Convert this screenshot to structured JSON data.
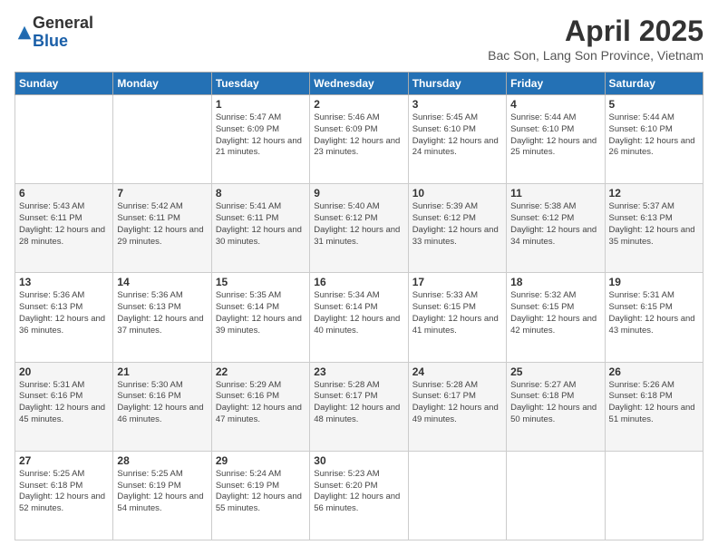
{
  "logo": {
    "general": "General",
    "blue": "Blue"
  },
  "title": {
    "month_year": "April 2025",
    "location": "Bac Son, Lang Son Province, Vietnam"
  },
  "headers": [
    "Sunday",
    "Monday",
    "Tuesday",
    "Wednesday",
    "Thursday",
    "Friday",
    "Saturday"
  ],
  "weeks": [
    [
      {
        "day": "",
        "sunrise": "",
        "sunset": "",
        "daylight": ""
      },
      {
        "day": "",
        "sunrise": "",
        "sunset": "",
        "daylight": ""
      },
      {
        "day": "1",
        "sunrise": "Sunrise: 5:47 AM",
        "sunset": "Sunset: 6:09 PM",
        "daylight": "Daylight: 12 hours and 21 minutes."
      },
      {
        "day": "2",
        "sunrise": "Sunrise: 5:46 AM",
        "sunset": "Sunset: 6:09 PM",
        "daylight": "Daylight: 12 hours and 23 minutes."
      },
      {
        "day": "3",
        "sunrise": "Sunrise: 5:45 AM",
        "sunset": "Sunset: 6:10 PM",
        "daylight": "Daylight: 12 hours and 24 minutes."
      },
      {
        "day": "4",
        "sunrise": "Sunrise: 5:44 AM",
        "sunset": "Sunset: 6:10 PM",
        "daylight": "Daylight: 12 hours and 25 minutes."
      },
      {
        "day": "5",
        "sunrise": "Sunrise: 5:44 AM",
        "sunset": "Sunset: 6:10 PM",
        "daylight": "Daylight: 12 hours and 26 minutes."
      }
    ],
    [
      {
        "day": "6",
        "sunrise": "Sunrise: 5:43 AM",
        "sunset": "Sunset: 6:11 PM",
        "daylight": "Daylight: 12 hours and 28 minutes."
      },
      {
        "day": "7",
        "sunrise": "Sunrise: 5:42 AM",
        "sunset": "Sunset: 6:11 PM",
        "daylight": "Daylight: 12 hours and 29 minutes."
      },
      {
        "day": "8",
        "sunrise": "Sunrise: 5:41 AM",
        "sunset": "Sunset: 6:11 PM",
        "daylight": "Daylight: 12 hours and 30 minutes."
      },
      {
        "day": "9",
        "sunrise": "Sunrise: 5:40 AM",
        "sunset": "Sunset: 6:12 PM",
        "daylight": "Daylight: 12 hours and 31 minutes."
      },
      {
        "day": "10",
        "sunrise": "Sunrise: 5:39 AM",
        "sunset": "Sunset: 6:12 PM",
        "daylight": "Daylight: 12 hours and 33 minutes."
      },
      {
        "day": "11",
        "sunrise": "Sunrise: 5:38 AM",
        "sunset": "Sunset: 6:12 PM",
        "daylight": "Daylight: 12 hours and 34 minutes."
      },
      {
        "day": "12",
        "sunrise": "Sunrise: 5:37 AM",
        "sunset": "Sunset: 6:13 PM",
        "daylight": "Daylight: 12 hours and 35 minutes."
      }
    ],
    [
      {
        "day": "13",
        "sunrise": "Sunrise: 5:36 AM",
        "sunset": "Sunset: 6:13 PM",
        "daylight": "Daylight: 12 hours and 36 minutes."
      },
      {
        "day": "14",
        "sunrise": "Sunrise: 5:36 AM",
        "sunset": "Sunset: 6:13 PM",
        "daylight": "Daylight: 12 hours and 37 minutes."
      },
      {
        "day": "15",
        "sunrise": "Sunrise: 5:35 AM",
        "sunset": "Sunset: 6:14 PM",
        "daylight": "Daylight: 12 hours and 39 minutes."
      },
      {
        "day": "16",
        "sunrise": "Sunrise: 5:34 AM",
        "sunset": "Sunset: 6:14 PM",
        "daylight": "Daylight: 12 hours and 40 minutes."
      },
      {
        "day": "17",
        "sunrise": "Sunrise: 5:33 AM",
        "sunset": "Sunset: 6:15 PM",
        "daylight": "Daylight: 12 hours and 41 minutes."
      },
      {
        "day": "18",
        "sunrise": "Sunrise: 5:32 AM",
        "sunset": "Sunset: 6:15 PM",
        "daylight": "Daylight: 12 hours and 42 minutes."
      },
      {
        "day": "19",
        "sunrise": "Sunrise: 5:31 AM",
        "sunset": "Sunset: 6:15 PM",
        "daylight": "Daylight: 12 hours and 43 minutes."
      }
    ],
    [
      {
        "day": "20",
        "sunrise": "Sunrise: 5:31 AM",
        "sunset": "Sunset: 6:16 PM",
        "daylight": "Daylight: 12 hours and 45 minutes."
      },
      {
        "day": "21",
        "sunrise": "Sunrise: 5:30 AM",
        "sunset": "Sunset: 6:16 PM",
        "daylight": "Daylight: 12 hours and 46 minutes."
      },
      {
        "day": "22",
        "sunrise": "Sunrise: 5:29 AM",
        "sunset": "Sunset: 6:16 PM",
        "daylight": "Daylight: 12 hours and 47 minutes."
      },
      {
        "day": "23",
        "sunrise": "Sunrise: 5:28 AM",
        "sunset": "Sunset: 6:17 PM",
        "daylight": "Daylight: 12 hours and 48 minutes."
      },
      {
        "day": "24",
        "sunrise": "Sunrise: 5:28 AM",
        "sunset": "Sunset: 6:17 PM",
        "daylight": "Daylight: 12 hours and 49 minutes."
      },
      {
        "day": "25",
        "sunrise": "Sunrise: 5:27 AM",
        "sunset": "Sunset: 6:18 PM",
        "daylight": "Daylight: 12 hours and 50 minutes."
      },
      {
        "day": "26",
        "sunrise": "Sunrise: 5:26 AM",
        "sunset": "Sunset: 6:18 PM",
        "daylight": "Daylight: 12 hours and 51 minutes."
      }
    ],
    [
      {
        "day": "27",
        "sunrise": "Sunrise: 5:25 AM",
        "sunset": "Sunset: 6:18 PM",
        "daylight": "Daylight: 12 hours and 52 minutes."
      },
      {
        "day": "28",
        "sunrise": "Sunrise: 5:25 AM",
        "sunset": "Sunset: 6:19 PM",
        "daylight": "Daylight: 12 hours and 54 minutes."
      },
      {
        "day": "29",
        "sunrise": "Sunrise: 5:24 AM",
        "sunset": "Sunset: 6:19 PM",
        "daylight": "Daylight: 12 hours and 55 minutes."
      },
      {
        "day": "30",
        "sunrise": "Sunrise: 5:23 AM",
        "sunset": "Sunset: 6:20 PM",
        "daylight": "Daylight: 12 hours and 56 minutes."
      },
      {
        "day": "",
        "sunrise": "",
        "sunset": "",
        "daylight": ""
      },
      {
        "day": "",
        "sunrise": "",
        "sunset": "",
        "daylight": ""
      },
      {
        "day": "",
        "sunrise": "",
        "sunset": "",
        "daylight": ""
      }
    ]
  ]
}
